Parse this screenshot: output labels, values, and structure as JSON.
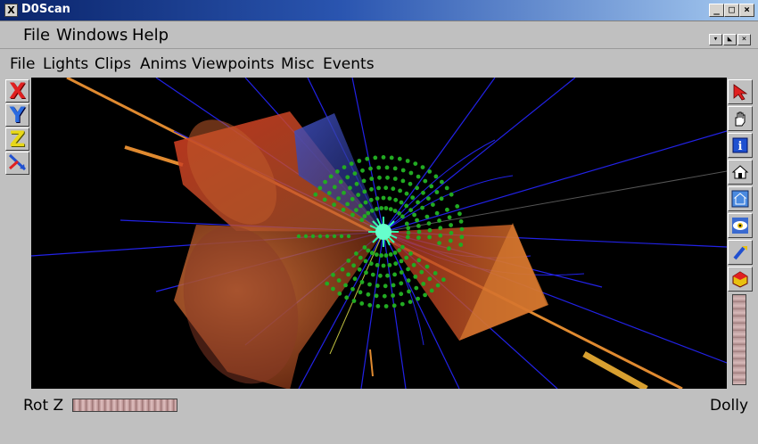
{
  "window": {
    "title": "D0Scan",
    "app_icon": "X"
  },
  "main_menu": [
    {
      "label": "File"
    },
    {
      "label": "Windows"
    },
    {
      "label": "Help"
    }
  ],
  "viewer_menu": [
    {
      "label": "File"
    },
    {
      "label": "Lights"
    },
    {
      "label": "Clips"
    },
    {
      "label": "Anims"
    },
    {
      "label": "Viewpoints"
    },
    {
      "label": "Misc"
    },
    {
      "label": "Events"
    }
  ],
  "left_tools": [
    {
      "icon": "x-axis-icon",
      "label": "X",
      "color": "#e02020"
    },
    {
      "icon": "y-axis-icon",
      "label": "Y",
      "color": "#2a6adf"
    },
    {
      "icon": "z-axis-icon",
      "label": "Z",
      "color": "#e8d818"
    },
    {
      "icon": "axis-swap-icon",
      "label": ""
    }
  ],
  "right_tools": [
    {
      "icon": "pick-arrow-icon"
    },
    {
      "icon": "hand-icon"
    },
    {
      "icon": "info-icon"
    },
    {
      "icon": "home-icon"
    },
    {
      "icon": "set-home-icon"
    },
    {
      "icon": "eye-icon"
    },
    {
      "icon": "flashlight-icon"
    },
    {
      "icon": "draw-style-icon"
    }
  ],
  "bottom": {
    "rot_label": "Rot Z",
    "dolly_label": "Dolly"
  },
  "colors": {
    "track": "#2222e6",
    "hits": "#22aa22",
    "vertex": "#33ffaa",
    "cone": "#cc6633",
    "beam": "#e08a30",
    "titlebar": "#0a246a"
  }
}
